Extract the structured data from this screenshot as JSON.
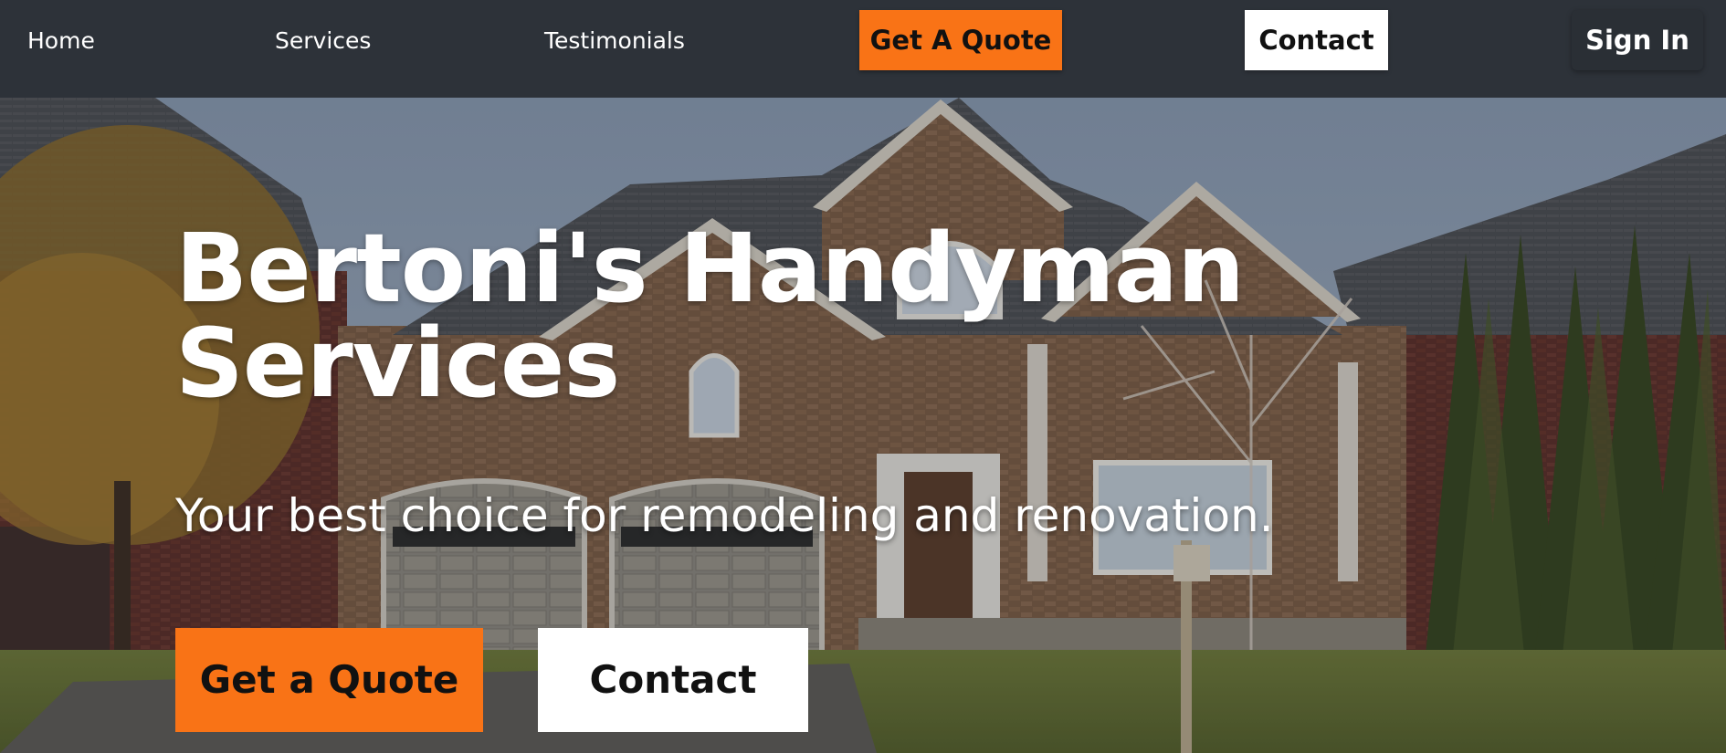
{
  "nav": {
    "home": "Home",
    "services": "Services",
    "testimonials": "Testimonials",
    "get_quote": "Get A Quote",
    "contact": "Contact",
    "sign_in": "Sign In"
  },
  "hero": {
    "title_line1": "Bertoni's Handyman",
    "title_line2": "Services",
    "subtitle": "Your best choice for remodeling and renovation.",
    "cta_quote": "Get a Quote",
    "cta_contact": "Contact"
  },
  "colors": {
    "nav_bg": "#2d3239",
    "accent": "#f97316",
    "white": "#ffffff"
  }
}
